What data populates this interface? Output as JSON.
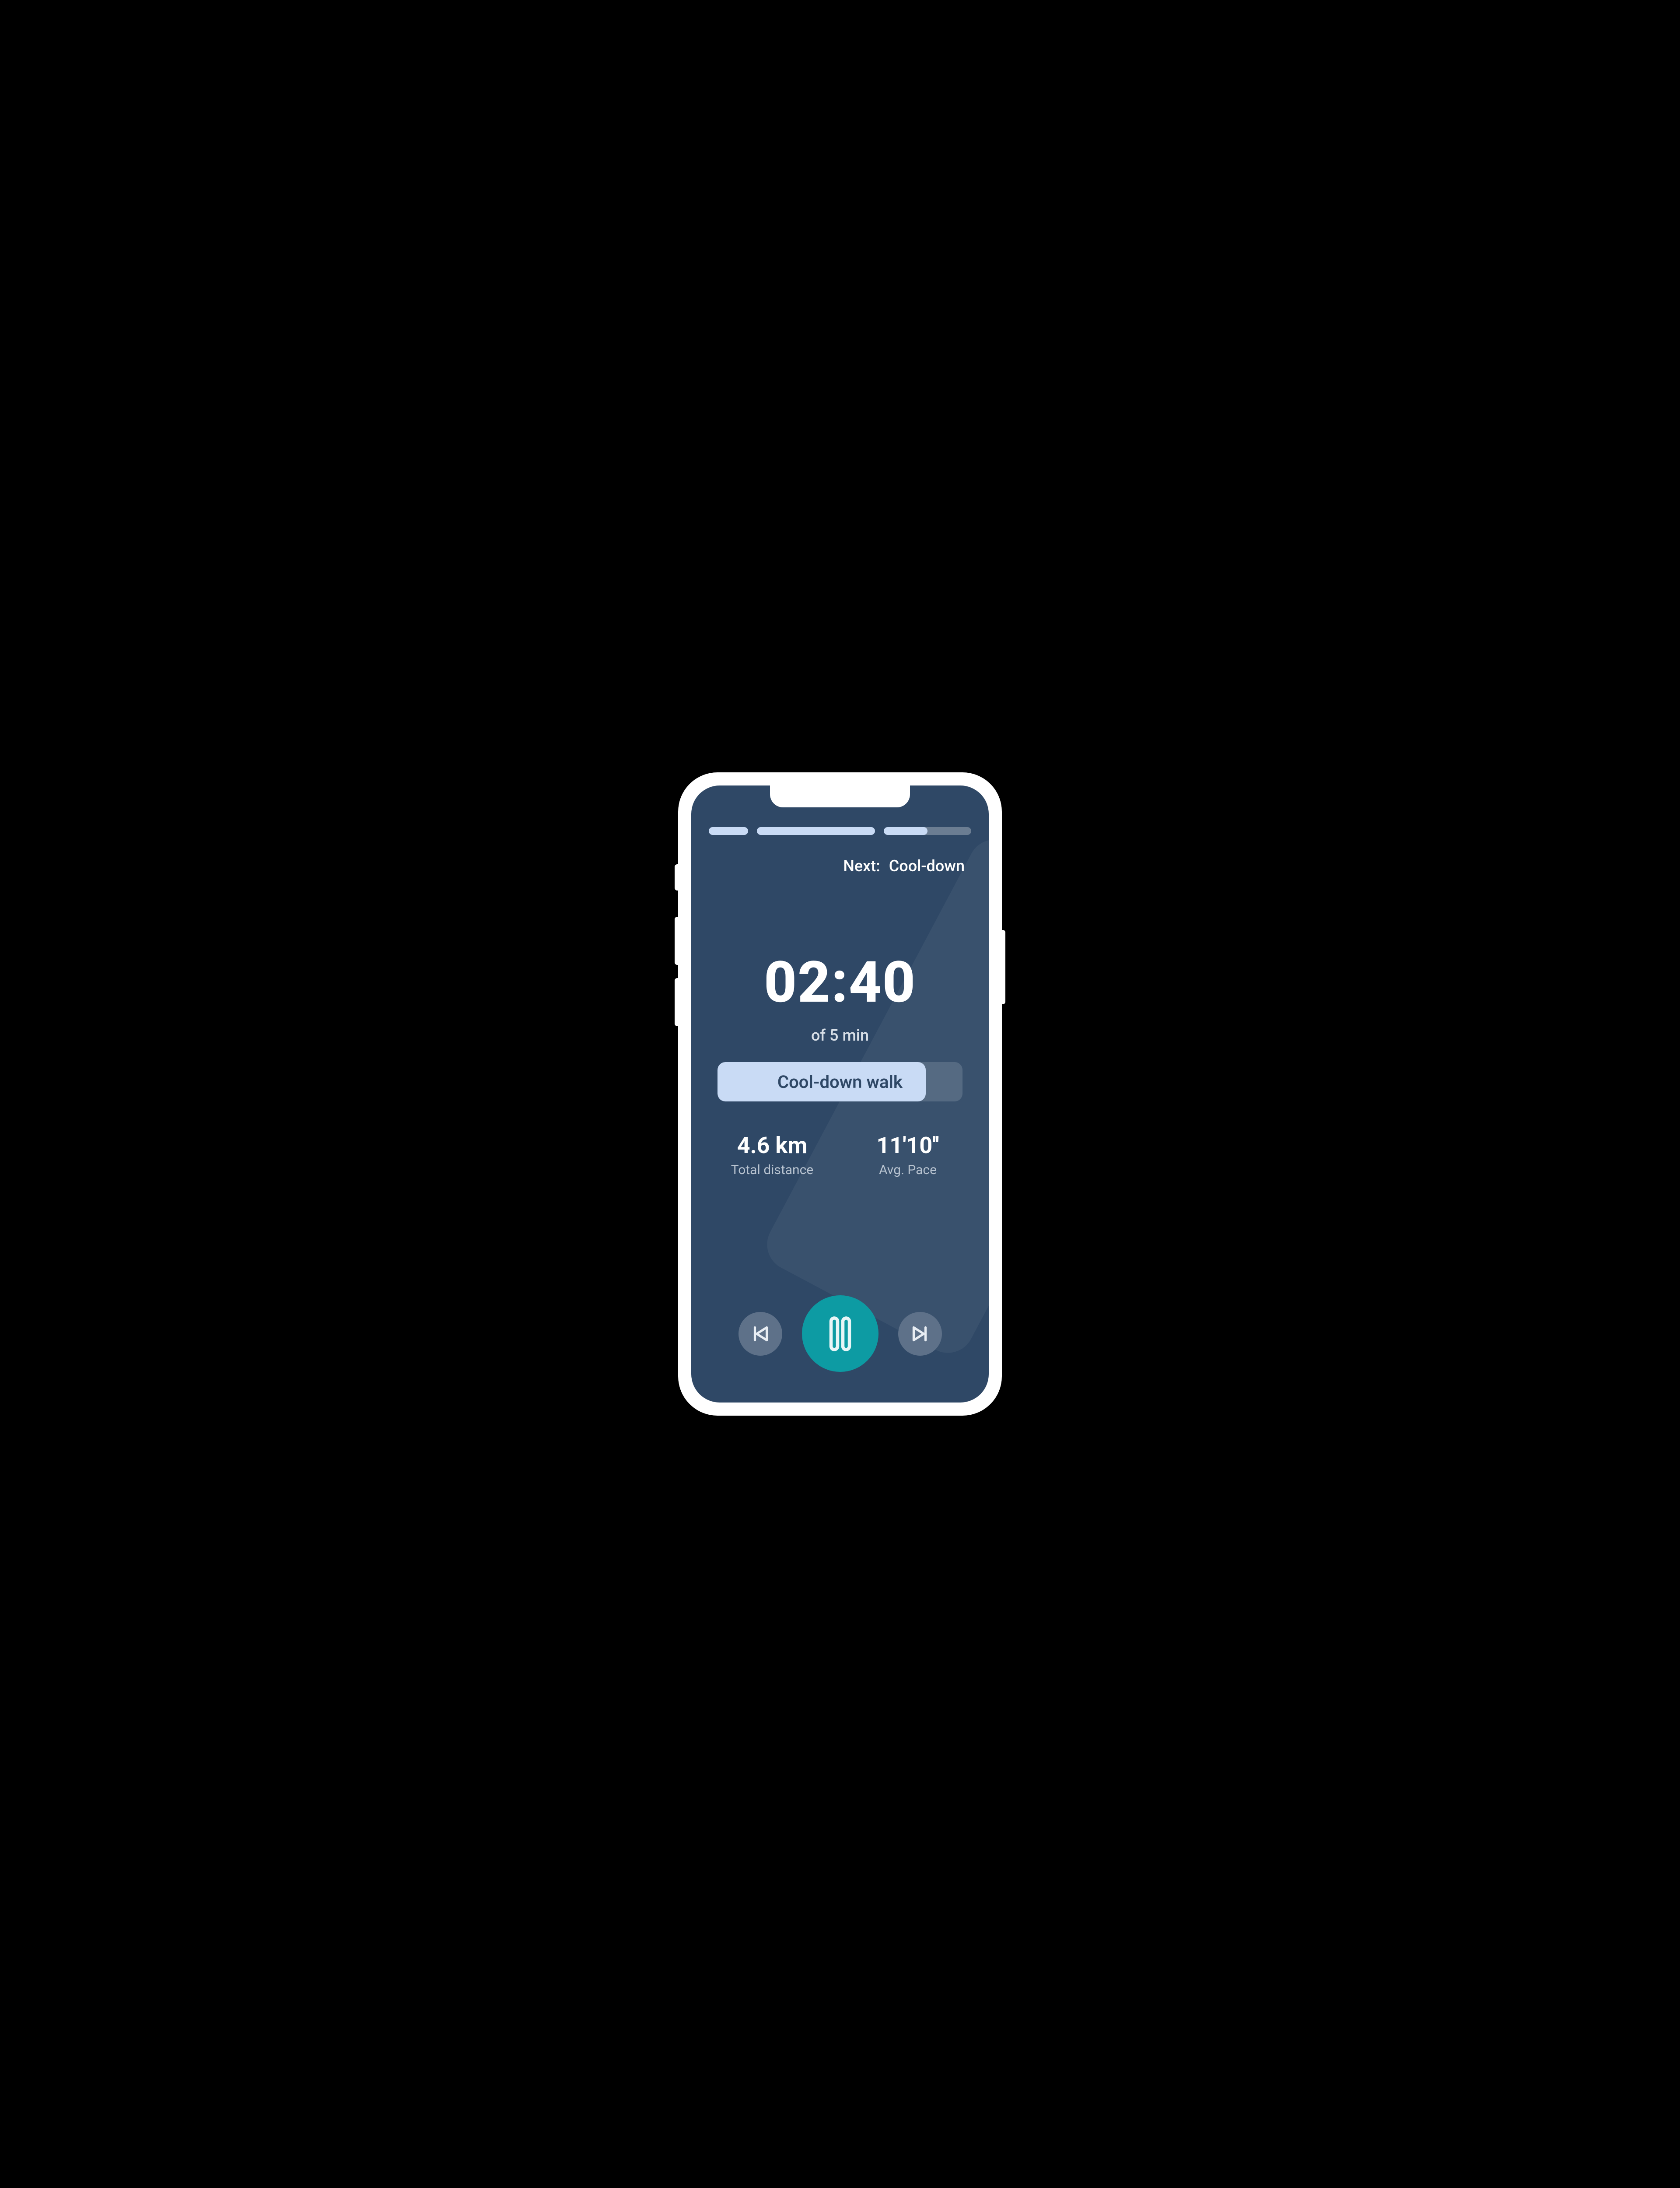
{
  "next": {
    "prefix": "Next:",
    "label": "Cool-down"
  },
  "timer": {
    "value": "02:40",
    "subtitle": "of 5 min"
  },
  "activity": {
    "label": "Cool-down walk"
  },
  "stats": {
    "distance": {
      "value": "4.6 km",
      "label": "Total distance"
    },
    "pace": {
      "value": "11'10''",
      "label": "Avg. Pace"
    }
  },
  "colors": {
    "accent": "#0d9ba3",
    "background": "#2f4866",
    "segment_fill": "#c9dbf5"
  },
  "icons": {
    "prev": "skip-previous-icon",
    "pause": "pause-icon",
    "next": "skip-next-icon"
  }
}
